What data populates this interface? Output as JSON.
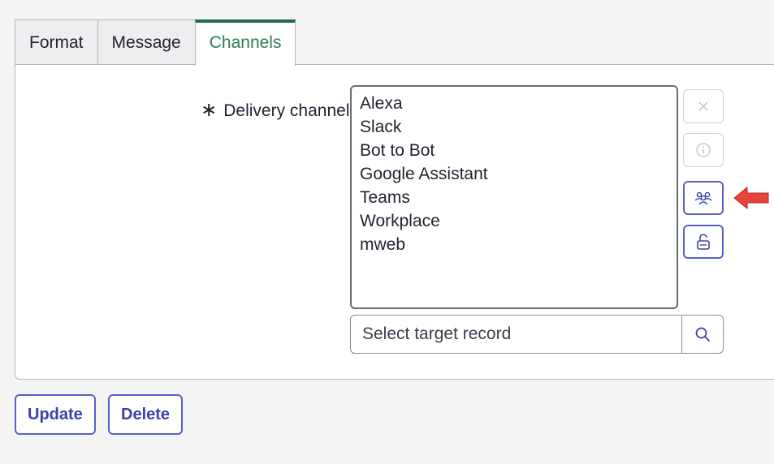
{
  "tabs": [
    {
      "label": "Format"
    },
    {
      "label": "Message"
    },
    {
      "label": "Channels",
      "active": true
    }
  ],
  "form": {
    "required_marker": "∗",
    "delivery_label": "Delivery channels",
    "channels": [
      "Alexa",
      "Slack",
      "Bot to Bot",
      "Google Assistant",
      "Teams",
      "Workplace",
      "mweb"
    ],
    "side_buttons": [
      {
        "icon": "close-icon",
        "enabled": false
      },
      {
        "icon": "info-icon",
        "enabled": false
      },
      {
        "icon": "group-icon",
        "enabled": true
      },
      {
        "icon": "unlock-icon",
        "enabled": true
      }
    ],
    "target_placeholder": "Select target record"
  },
  "actions": {
    "update_label": "Update",
    "delete_label": "Delete"
  },
  "colors": {
    "accent": "#5a5fc4",
    "active_tab": "#1f6b47",
    "arrow": "#e8443a"
  }
}
